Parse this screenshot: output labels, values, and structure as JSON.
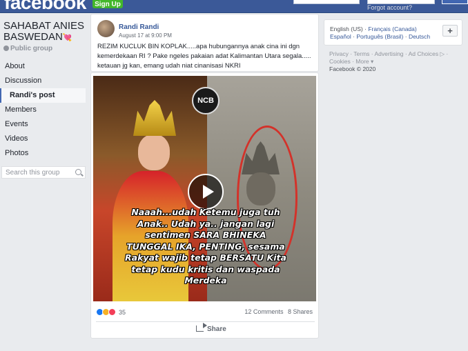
{
  "topbar": {
    "logo": "facebook",
    "signup_label": "Sign Up",
    "forgot": "Forgot account?"
  },
  "group": {
    "name": "SAHABAT ANIES BASWEDAN",
    "name_emoji": "💘",
    "privacy": "Public group"
  },
  "nav": {
    "items": [
      {
        "label": "About",
        "active": false
      },
      {
        "label": "Discussion",
        "active": false
      },
      {
        "label": "Randi's post",
        "active": true
      },
      {
        "label": "Members",
        "active": false
      },
      {
        "label": "Events",
        "active": false
      },
      {
        "label": "Videos",
        "active": false
      },
      {
        "label": "Photos",
        "active": false
      }
    ]
  },
  "search": {
    "placeholder": "Search this group",
    "icon": "search-icon"
  },
  "post": {
    "author": "Randi Randi",
    "date": "August 17 at 9:00 PM",
    "text": "REZIM KUCLUK BIN KOPLAK.....apa hubungannya anak cina ini dgn kemerdekaan RI ? Pake ngeles pakaian adat Kalimantan Utara segala..... ketauan jg kan, emang udah niat cinanisasi NKRI"
  },
  "video": {
    "badge": "NCB",
    "caption": "Naaah...udah Ketemu juga tuh\nAnak.. Udah ya.. jangan lagi\nsentimen SARA BHINEKA\nTUNGGAL IKA, PENTING, sesama\nRakyat wajib tetap BERSATU Kita\ntetap kudu kritis dan waspada\nMerdeka"
  },
  "engagement": {
    "reactions": "35",
    "comments": "12 Comments",
    "shares": "8 Shares",
    "share_label": "Share"
  },
  "sidebar": {
    "lang_line1": {
      "current": "English (US)",
      "sep": "·",
      "alt1": "Français (Canada)"
    },
    "lang_line2": {
      "alt2": "Español",
      "sep": "·",
      "alt3": "Português (Brasil)",
      "alt4": "Deutsch"
    },
    "plus": "+",
    "footer_line1": "Privacy · Terms · Advertising · Ad Choices ▷ ·",
    "footer_line2": "Cookies · More ▾",
    "copyright": "Facebook © 2020"
  },
  "colors": {
    "brand": "#3b5998",
    "link": "#365899",
    "background": "#e9ebee"
  }
}
